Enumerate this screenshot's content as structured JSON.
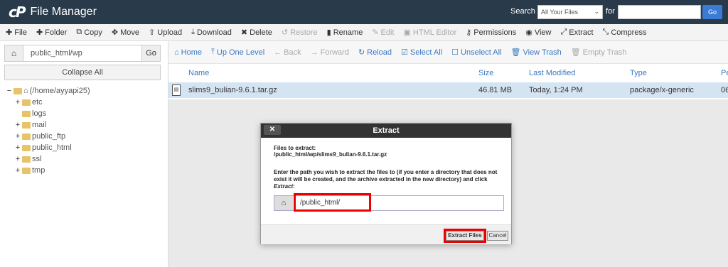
{
  "app": {
    "logo": "cP",
    "title": "File Manager"
  },
  "search": {
    "label": "Search",
    "scope": "All Your Files",
    "for_label": "for",
    "go": "Go"
  },
  "colors": {
    "topbar": "#293a4a",
    "link": "#3a78c2",
    "selected_row": "#d5e4f2",
    "highlight": "#e00000"
  },
  "toolbar": [
    {
      "icon": "plus-icon",
      "glyph": "✚",
      "label": "File",
      "enabled": true
    },
    {
      "icon": "plus-icon",
      "glyph": "✚",
      "label": "Folder",
      "enabled": true
    },
    {
      "icon": "copy-icon",
      "glyph": "⧉",
      "label": "Copy",
      "enabled": true
    },
    {
      "icon": "move-icon",
      "glyph": "✥",
      "label": "Move",
      "enabled": true
    },
    {
      "icon": "upload-icon",
      "glyph": "⇪",
      "label": "Upload",
      "enabled": true
    },
    {
      "icon": "download-icon",
      "glyph": "⤓",
      "label": "Download",
      "enabled": true
    },
    {
      "icon": "delete-icon",
      "glyph": "✖",
      "label": "Delete",
      "enabled": true
    },
    {
      "icon": "restore-icon",
      "glyph": "↺",
      "label": "Restore",
      "enabled": false
    },
    {
      "icon": "rename-icon",
      "glyph": "▮",
      "label": "Rename",
      "enabled": true
    },
    {
      "icon": "edit-icon",
      "glyph": "✎",
      "label": "Edit",
      "enabled": false
    },
    {
      "icon": "html-editor-icon",
      "glyph": "▣",
      "label": "HTML Editor",
      "enabled": false
    },
    {
      "icon": "key-icon",
      "glyph": "⚷",
      "label": "Permissions",
      "enabled": true
    },
    {
      "icon": "eye-icon",
      "glyph": "◉",
      "label": "View",
      "enabled": true
    },
    {
      "icon": "extract-icon",
      "glyph": "⤢",
      "label": "Extract",
      "enabled": true
    },
    {
      "icon": "compress-icon",
      "glyph": "⤡",
      "label": "Compress",
      "enabled": true
    }
  ],
  "sidebar": {
    "path": "public_html/wp",
    "go": "Go",
    "collapse": "Collapse All",
    "tree": [
      {
        "toggle": "−",
        "label": "(/home/ayyapi25)",
        "home": true,
        "indent": 0
      },
      {
        "toggle": "+",
        "label": "etc",
        "home": false,
        "indent": 1
      },
      {
        "toggle": "",
        "label": "logs",
        "home": false,
        "indent": 1
      },
      {
        "toggle": "+",
        "label": "mail",
        "home": false,
        "indent": 1
      },
      {
        "toggle": "+",
        "label": "public_ftp",
        "home": false,
        "indent": 1
      },
      {
        "toggle": "+",
        "label": "public_html",
        "home": false,
        "indent": 1
      },
      {
        "toggle": "+",
        "label": "ssl",
        "home": false,
        "indent": 1
      },
      {
        "toggle": "+",
        "label": "tmp",
        "home": false,
        "indent": 1
      }
    ]
  },
  "nav": [
    {
      "icon": "home-icon",
      "glyph": "⌂",
      "label": "Home",
      "enabled": true
    },
    {
      "icon": "up-level-icon",
      "glyph": "⤒",
      "label": "Up One Level",
      "enabled": true
    },
    {
      "icon": "back-icon",
      "glyph": "←",
      "label": "Back",
      "enabled": false
    },
    {
      "icon": "forward-icon",
      "glyph": "→",
      "label": "Forward",
      "enabled": false
    },
    {
      "icon": "reload-icon",
      "glyph": "↻",
      "label": "Reload",
      "enabled": true
    },
    {
      "icon": "select-all-icon",
      "glyph": "☑",
      "label": "Select All",
      "enabled": true
    },
    {
      "icon": "unselect-all-icon",
      "glyph": "☐",
      "label": "Unselect All",
      "enabled": true
    },
    {
      "icon": "trash-icon",
      "glyph": "🗑",
      "label": "View Trash",
      "enabled": true
    },
    {
      "icon": "trash-icon",
      "glyph": "🗑",
      "label": "Empty Trash",
      "enabled": false
    }
  ],
  "table": {
    "headers": {
      "name": "Name",
      "size": "Size",
      "modified": "Last Modified",
      "type": "Type",
      "perms": "Pe"
    },
    "row": {
      "name": "slims9_bulian-9.6.1.tar.gz",
      "size": "46.81 MB",
      "modified": "Today, 1:24 PM",
      "type": "package/x-generic",
      "perms": "06"
    }
  },
  "modal": {
    "title": "Extract",
    "close": "✕",
    "files_label": "Files to extract:",
    "file_path": "/public_html/wp/slims9_bulian-9.6.1.tar.gz",
    "description": "Enter the path you wish to extract the files to (if you enter a directory that does not exist it will be created, and the archive extracted in the new directory) and click",
    "description_em": "Extract",
    "description_end": ":",
    "destination": "/public_html/",
    "extract_button": "Extract Files",
    "cancel_button": "Cancel"
  }
}
